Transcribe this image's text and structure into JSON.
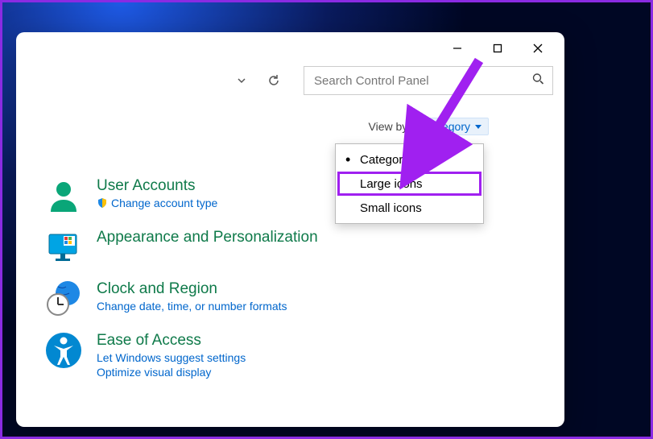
{
  "searchbox": {
    "placeholder": "Search Control Panel"
  },
  "viewby": {
    "label": "View by:",
    "selected": "Category",
    "options": [
      "Category",
      "Large icons",
      "Small icons"
    ]
  },
  "categories": [
    {
      "title": "User Accounts",
      "links": [
        "Change account type"
      ],
      "shield_on": [
        0
      ]
    },
    {
      "title": "Appearance and Personalization",
      "links": []
    },
    {
      "title": "Clock and Region",
      "links": [
        "Change date, time, or number formats"
      ]
    },
    {
      "title": "Ease of Access",
      "links": [
        "Let Windows suggest settings",
        "Optimize visual display"
      ]
    }
  ],
  "annotation": {
    "highlighted_option": "Large icons"
  }
}
